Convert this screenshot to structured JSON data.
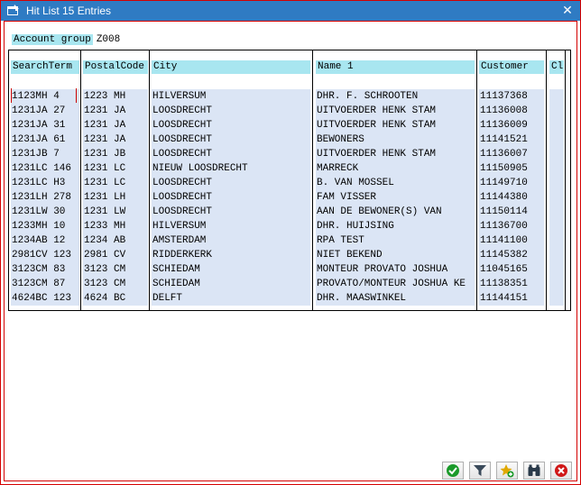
{
  "window": {
    "title": "Hit List 15 Entries",
    "close_label": "✕"
  },
  "filter": {
    "label": "Account group",
    "value": "Z008"
  },
  "table": {
    "headers": [
      "SearchTerm",
      "PostalCode",
      "City",
      "Name 1",
      "Customer",
      "Cl"
    ],
    "rows": [
      [
        "1123MH 4",
        "1223 MH",
        "HILVERSUM",
        "DHR. F. SCHROOTEN",
        "11137368",
        ""
      ],
      [
        "1231JA 27",
        "1231 JA",
        "LOOSDRECHT",
        "UITVOERDER HENK STAM",
        "11136008",
        ""
      ],
      [
        "1231JA 31",
        "1231 JA",
        "LOOSDRECHT",
        "UITVOERDER HENK STAM",
        "11136009",
        ""
      ],
      [
        "1231JA 61",
        "1231 JA",
        "LOOSDRECHT",
        "BEWONERS",
        "11141521",
        ""
      ],
      [
        "1231JB 7",
        "1231 JB",
        "LOOSDRECHT",
        "UITVOERDER HENK STAM",
        "11136007",
        ""
      ],
      [
        "1231LC 146",
        "1231 LC",
        "NIEUW LOOSDRECHT",
        "MARRECK",
        "11150905",
        ""
      ],
      [
        "1231LC H3",
        "1231 LC",
        "LOOSDRECHT",
        "B. VAN MOSSEL",
        "11149710",
        ""
      ],
      [
        "1231LH 278",
        "1231 LH",
        "LOOSDRECHT",
        "FAM VISSER",
        "11144380",
        ""
      ],
      [
        "1231LW 30",
        "1231 LW",
        "LOOSDRECHT",
        "AAN DE BEWONER(S) VAN",
        "11150114",
        ""
      ],
      [
        "1233MH 10",
        "1233 MH",
        "HILVERSUM",
        "DHR. HUIJSING",
        "11136700",
        ""
      ],
      [
        "1234AB 12",
        "1234 AB",
        "AMSTERDAM",
        "RPA TEST",
        "11141100",
        ""
      ],
      [
        "2981CV 123",
        "2981 CV",
        "RIDDERKERK",
        "NIET BEKEND",
        "11145382",
        ""
      ],
      [
        "3123CM 83",
        "3123 CM",
        "SCHIEDAM",
        "MONTEUR PROVATO JOSHUA",
        "11045165",
        ""
      ],
      [
        "3123CM 87",
        "3123 CM",
        "SCHIEDAM",
        "PROVATO/MONTEUR JOSHUA KE",
        "11138351",
        ""
      ],
      [
        "4624BC 123",
        "4624 BC",
        "DELFT",
        "DHR. MAASWINKEL",
        "11144151",
        ""
      ]
    ]
  },
  "footer_buttons": [
    {
      "name": "continue-button",
      "icon": "checkmark-icon",
      "color": "#1a9a2a"
    },
    {
      "name": "filter-button",
      "icon": "funnel-icon",
      "color": "#3a4a5a"
    },
    {
      "name": "new-search-button",
      "icon": "star-plus-icon",
      "color": "#e0a800"
    },
    {
      "name": "find-button",
      "icon": "binoculars-icon",
      "color": "#2a3a4a"
    },
    {
      "name": "cancel-button",
      "icon": "cancel-icon",
      "color": "#d01818"
    }
  ],
  "colors": {
    "titlebar": "#2f7bc3",
    "header_bg": "#a8e6f0",
    "cell_bg": "#dbe5f5",
    "frame": "#d40000"
  }
}
